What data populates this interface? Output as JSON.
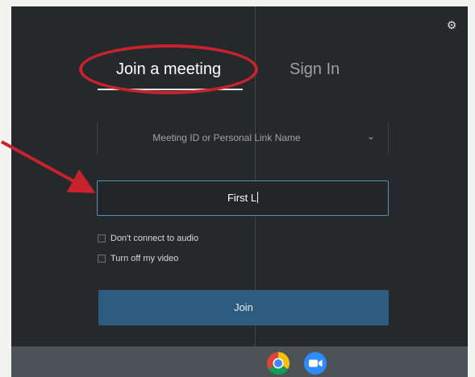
{
  "tabs": {
    "join": "Join a meeting",
    "signin": "Sign In"
  },
  "meeting_select": {
    "placeholder": "Meeting ID or Personal Link Name",
    "icon": "chevron-down-icon"
  },
  "name_field": {
    "value": "First L"
  },
  "options": [
    {
      "label": "Don't connect to audio",
      "checked": false
    },
    {
      "label": "Turn off my video",
      "checked": false
    }
  ],
  "join_button": {
    "label": "Join"
  },
  "taskbar": {
    "icons": [
      "chrome-icon",
      "zoom-icon"
    ]
  },
  "colors": {
    "background": "#26292c",
    "accent_button": "#2d5c80",
    "input_border": "#5f8db0",
    "annotation_red": "#c8232c",
    "taskbar": "#4d5257"
  }
}
